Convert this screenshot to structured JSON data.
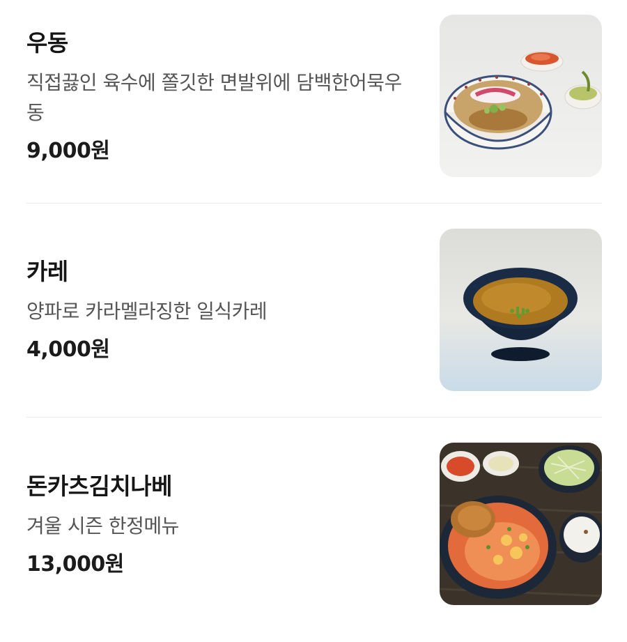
{
  "menu": {
    "items": [
      {
        "name": "우동",
        "description": "직접끓인 육수에 쫄깃한 면발위에 담백한어묵우동",
        "price": "9,000원",
        "photo_icon": "udon-photo"
      },
      {
        "name": "카레",
        "description": "양파로 카라멜라징한 일식카레",
        "price": "4,000원",
        "photo_icon": "curry-photo"
      },
      {
        "name": "돈카츠김치나베",
        "description": "겨울 시즌 한정메뉴",
        "price": "13,000원",
        "photo_icon": "tonkatsu-kimchi-nabe-photo"
      }
    ]
  }
}
